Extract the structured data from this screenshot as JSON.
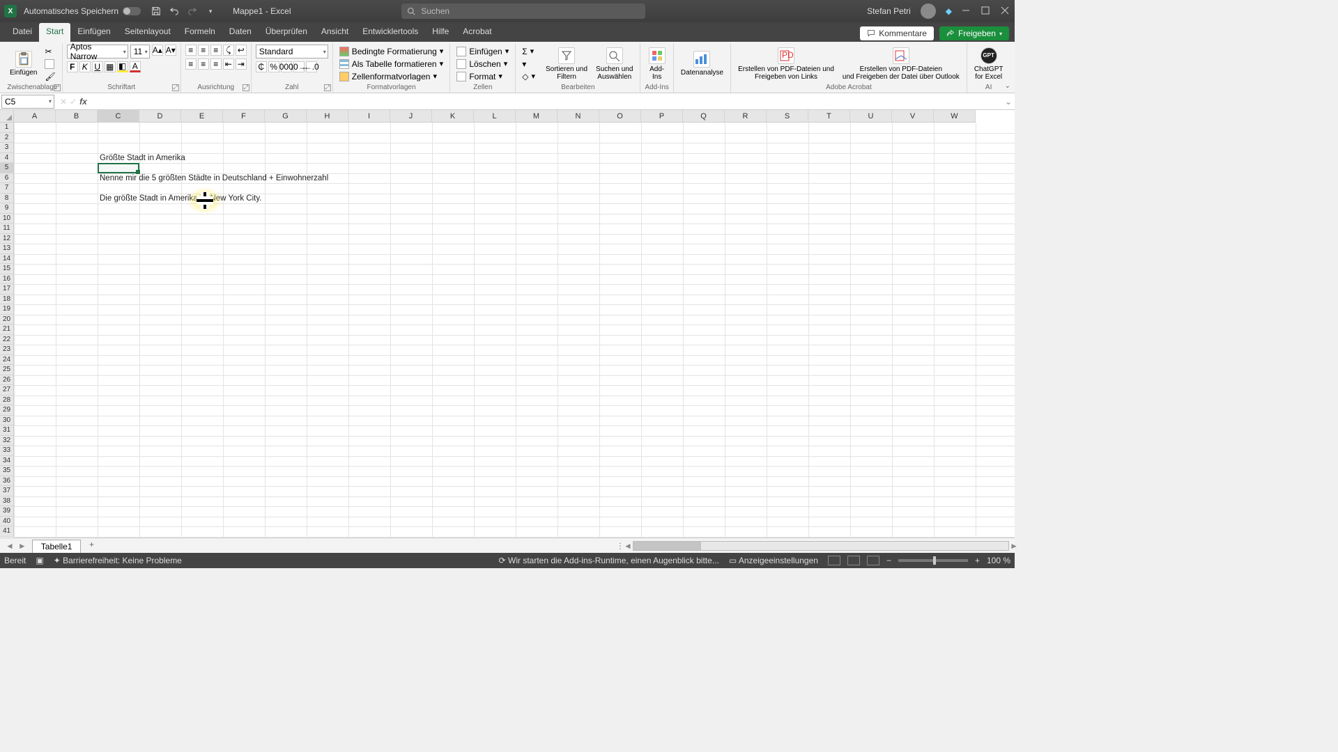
{
  "titlebar": {
    "autosave_label": "Automatisches Speichern",
    "doc_name": "Mappe1",
    "app_name": "Excel",
    "search_placeholder": "Suchen",
    "user_name": "Stefan Petri"
  },
  "tabs": {
    "items": [
      "Datei",
      "Start",
      "Einfügen",
      "Seitenlayout",
      "Formeln",
      "Daten",
      "Überprüfen",
      "Ansicht",
      "Entwicklertools",
      "Hilfe",
      "Acrobat"
    ],
    "active_index": 1,
    "comments": "Kommentare",
    "share": "Freigeben"
  },
  "ribbon": {
    "clipboard": {
      "paste": "Einfügen",
      "group": "Zwischenablage"
    },
    "font": {
      "name": "Aptos Narrow",
      "size": "11",
      "group": "Schriftart"
    },
    "align": {
      "group": "Ausrichtung"
    },
    "number": {
      "format": "Standard",
      "group": "Zahl"
    },
    "styles": {
      "cond": "Bedingte Formatierung",
      "table": "Als Tabelle formatieren",
      "cellstyles": "Zellenformatvorlagen",
      "group": "Formatvorlagen"
    },
    "cells": {
      "insert": "Einfügen",
      "delete": "Löschen",
      "format": "Format",
      "group": "Zellen"
    },
    "editing": {
      "sort": "Sortieren und\nFiltern",
      "find": "Suchen und\nAuswählen",
      "group": "Bearbeiten"
    },
    "addins": {
      "label": "Add-\nIns",
      "group": "Add-Ins"
    },
    "analysis": {
      "label": "Datenanalyse"
    },
    "acrobat": {
      "link": "Erstellen von PDF-Dateien und\nFreigeben von Links",
      "outlook": "Erstellen von PDF-Dateien\nund Freigeben der Datei über Outlook",
      "group": "Adobe Acrobat"
    },
    "ai": {
      "label": "ChatGPT\nfor Excel",
      "group": "AI"
    }
  },
  "namebox": "C5",
  "formula": "",
  "columns": [
    "A",
    "B",
    "C",
    "D",
    "E",
    "F",
    "G",
    "H",
    "I",
    "J",
    "K",
    "L",
    "M",
    "N",
    "O",
    "P",
    "Q",
    "R",
    "S",
    "T",
    "U",
    "V",
    "W"
  ],
  "active_col_index": 2,
  "row_count": 41,
  "active_row": 5,
  "cells": {
    "c4": "Größte Stadt in Amerika",
    "c6": "Nenne mir die 5 größten Städte in Deutschland + Einwohnerzahl",
    "c8": "Die größte Stadt in Amerika ist New York City."
  },
  "sheet": {
    "tab1": "Tabelle1"
  },
  "statusbar": {
    "ready": "Bereit",
    "access": "Barrierefreiheit: Keine Probleme",
    "runtime": "Wir starten die Add-ins-Runtime, einen Augenblick bitte...",
    "display": "Anzeigeeinstellungen",
    "zoom": "100 %"
  }
}
